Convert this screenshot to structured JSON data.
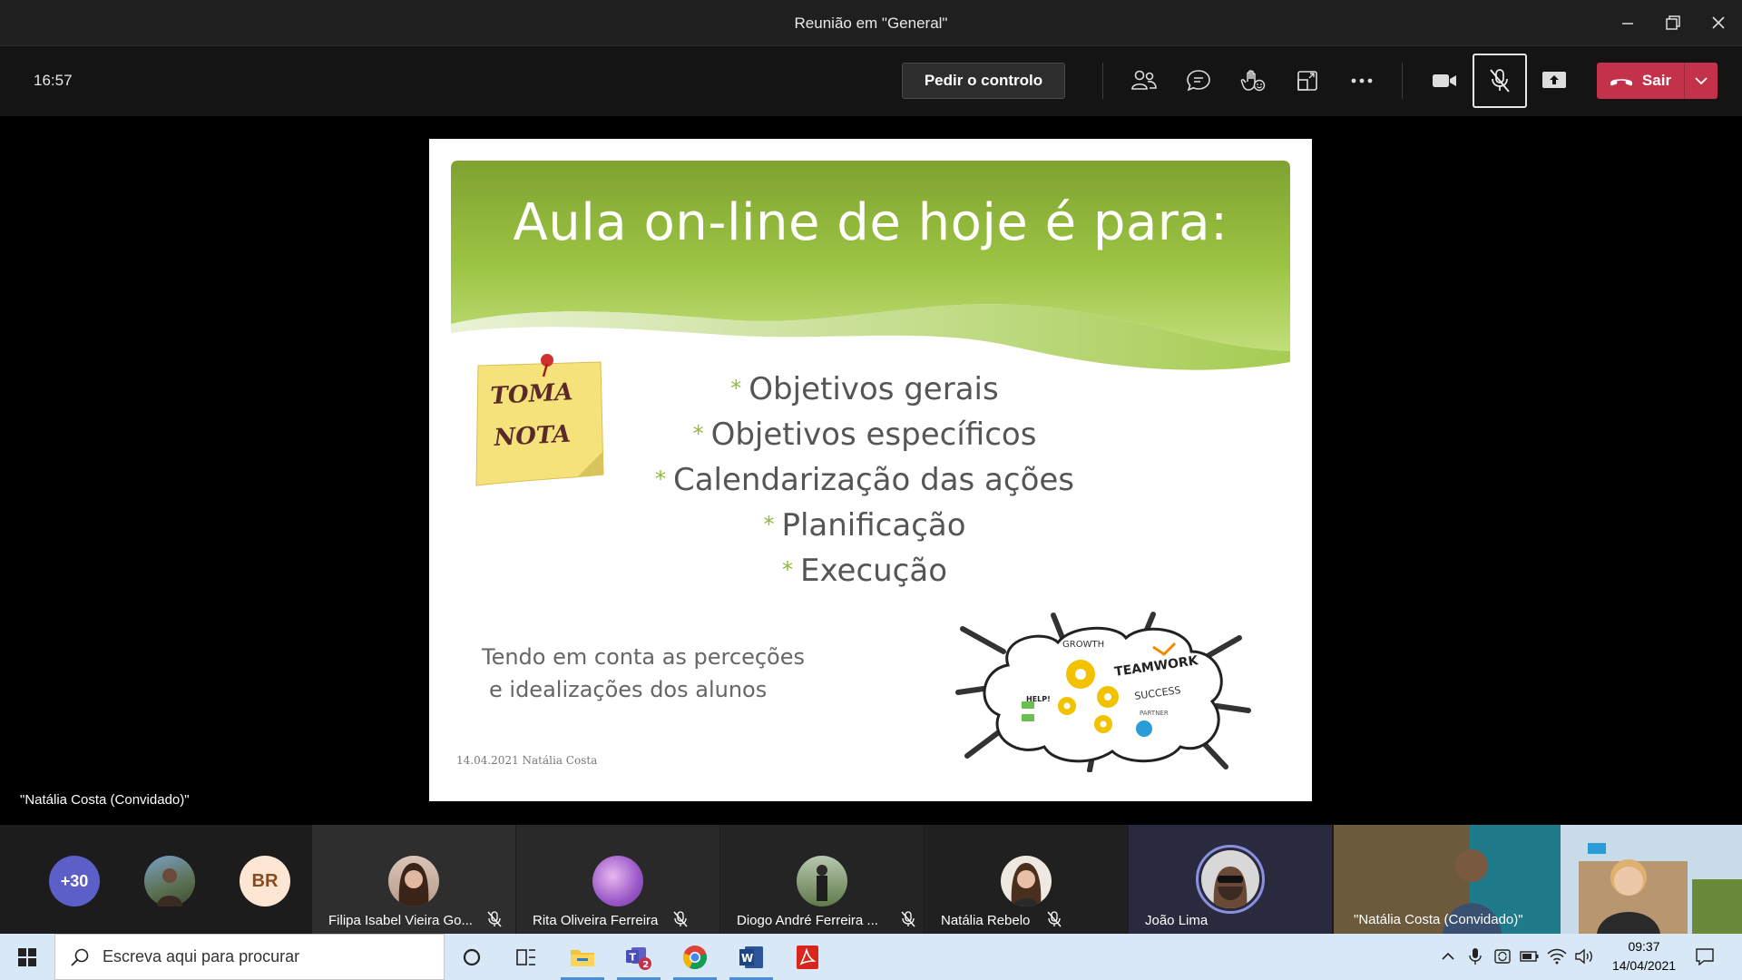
{
  "window": {
    "title": "Reunião em \"General\""
  },
  "toolbar": {
    "clock": "16:57",
    "request_control": "Pedir o controlo",
    "leave_label": "Sair"
  },
  "slide": {
    "title": "Aula on-line de hoje é para:",
    "note_line1": "TOMA",
    "note_line2": "NOTA",
    "bullets": [
      "Objetivos gerais",
      "Objetivos específicos",
      "Calendarização das ações",
      "Planificação",
      "Execução"
    ],
    "bullet_marker": "*",
    "note_text_line1": "Tendo em conta as perceções",
    "note_text_line2": "e idealizações dos alunos",
    "footer": "14.04.2021 Natália Costa",
    "image_words": [
      "GROWTH",
      "TEAMWORK",
      "SUCCESS",
      "PARTNER",
      "HELP!"
    ]
  },
  "presenter_label": "\"Natália Costa (Convidado)\"",
  "participants_strip": {
    "more_count": "+30",
    "initials": "BR",
    "tiles": [
      {
        "name": "Filipa Isabel Vieira Go...",
        "muted": true
      },
      {
        "name": "Rita Oliveira Ferreira",
        "muted": true
      },
      {
        "name": "Diogo André Ferreira ...",
        "muted": true
      },
      {
        "name": "Natália Rebelo",
        "muted": true
      },
      {
        "name": "João Lima",
        "muted": false
      }
    ],
    "video_name": "\"Natália Costa (Convidado)\""
  },
  "taskbar": {
    "search_placeholder": "Escreva aqui para procurar",
    "teams_badge": "2",
    "time": "09:37",
    "date": "14/04/2021"
  },
  "colors": {
    "leave": "#c4314b",
    "slide_green": "#8dbb3a",
    "taskbar": "#d9e8f6"
  }
}
